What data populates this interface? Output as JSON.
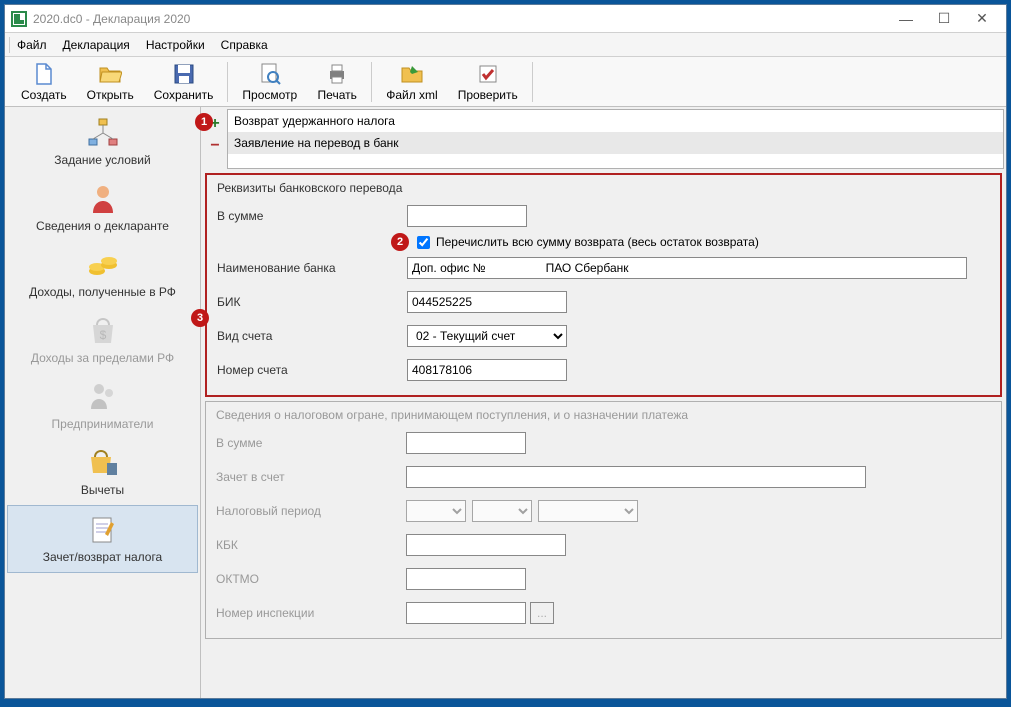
{
  "window": {
    "title": "2020.dc0 - Декларация 2020"
  },
  "menubar": [
    "Файл",
    "Декларация",
    "Настройки",
    "Справка"
  ],
  "toolbar": [
    {
      "label": "Создать",
      "icon": "file-new"
    },
    {
      "label": "Открыть",
      "icon": "folder-open"
    },
    {
      "label": "Сохранить",
      "icon": "save"
    },
    {
      "label": "Просмотр",
      "icon": "preview"
    },
    {
      "label": "Печать",
      "icon": "print"
    },
    {
      "label": "Файл xml",
      "icon": "xml"
    },
    {
      "label": "Проверить",
      "icon": "check"
    }
  ],
  "sidebar": [
    {
      "label": "Задание условий",
      "disabled": false
    },
    {
      "label": "Сведения о декларанте",
      "disabled": false
    },
    {
      "label": "Доходы, полученные в РФ",
      "disabled": false
    },
    {
      "label": "Доходы за пределами РФ",
      "disabled": true
    },
    {
      "label": "Предприниматели",
      "disabled": true
    },
    {
      "label": "Вычеты",
      "disabled": false
    },
    {
      "label": "Зачет/возврат налога",
      "disabled": false,
      "active": true
    }
  ],
  "list": {
    "row1": "Возврат удержанного налога",
    "row2": "Заявление на перевод в банк"
  },
  "markers": {
    "m1": "1",
    "m2": "2",
    "m3": "3"
  },
  "bank": {
    "title": "Реквизиты банковского перевода",
    "sum_label": "В сумме",
    "sum_value": "",
    "full_refund_label": "Перечислить всю сумму возврата (весь остаток возврата)",
    "name_label": "Наименование банка",
    "name_value": "Доп. офис №                  ПАО Сбербанк",
    "bik_label": "БИК",
    "bik_value": "044525225",
    "acct_type_label": "Вид счета",
    "acct_type_value": "02 - Текущий счет",
    "acct_num_label": "Номер счета",
    "acct_num_value": "408178106"
  },
  "tax": {
    "title": "Сведения о налоговом огране, принимающем поступления, и о назначении платежа",
    "sum_label": "В сумме",
    "credit_label": "Зачет в счет",
    "period_label": "Налоговый период",
    "kbk_label": "КБК",
    "oktmo_label": "ОКТМО",
    "insp_label": "Номер инспекции"
  }
}
